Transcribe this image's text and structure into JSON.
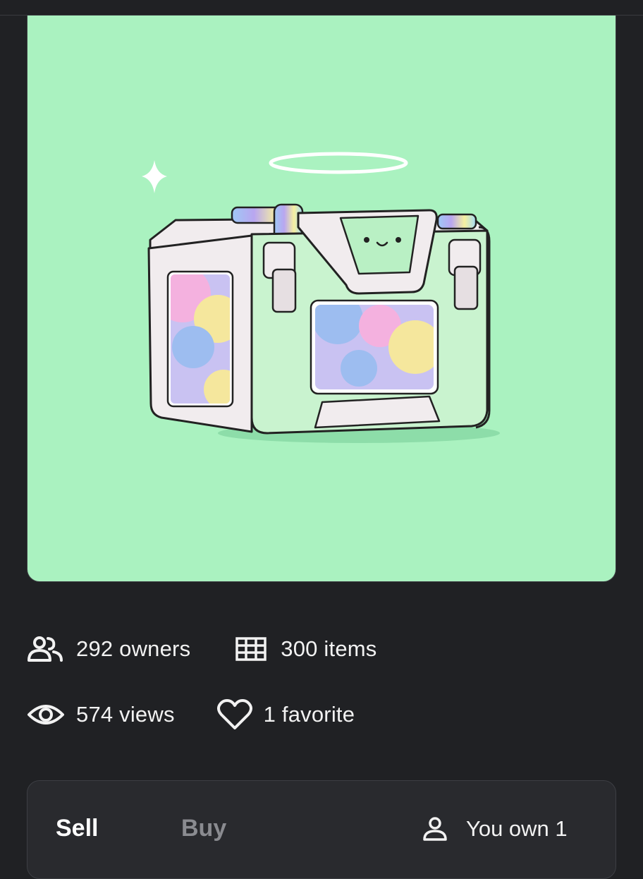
{
  "nft": {
    "image_description_icon": "rainbow-treasure-chest-with-halo",
    "background_color": "#aaf2c0"
  },
  "stats": {
    "owners": "292 owners",
    "items": "300 items",
    "views": "574 views",
    "favorites": "1 favorite"
  },
  "trade": {
    "sell_tab": "Sell",
    "buy_tab": "Buy",
    "own_label": "You own 1"
  },
  "icons": {
    "owners": "users-icon",
    "items": "grid-icon",
    "views": "eye-icon",
    "favorites": "heart-icon",
    "own": "user-icon"
  }
}
